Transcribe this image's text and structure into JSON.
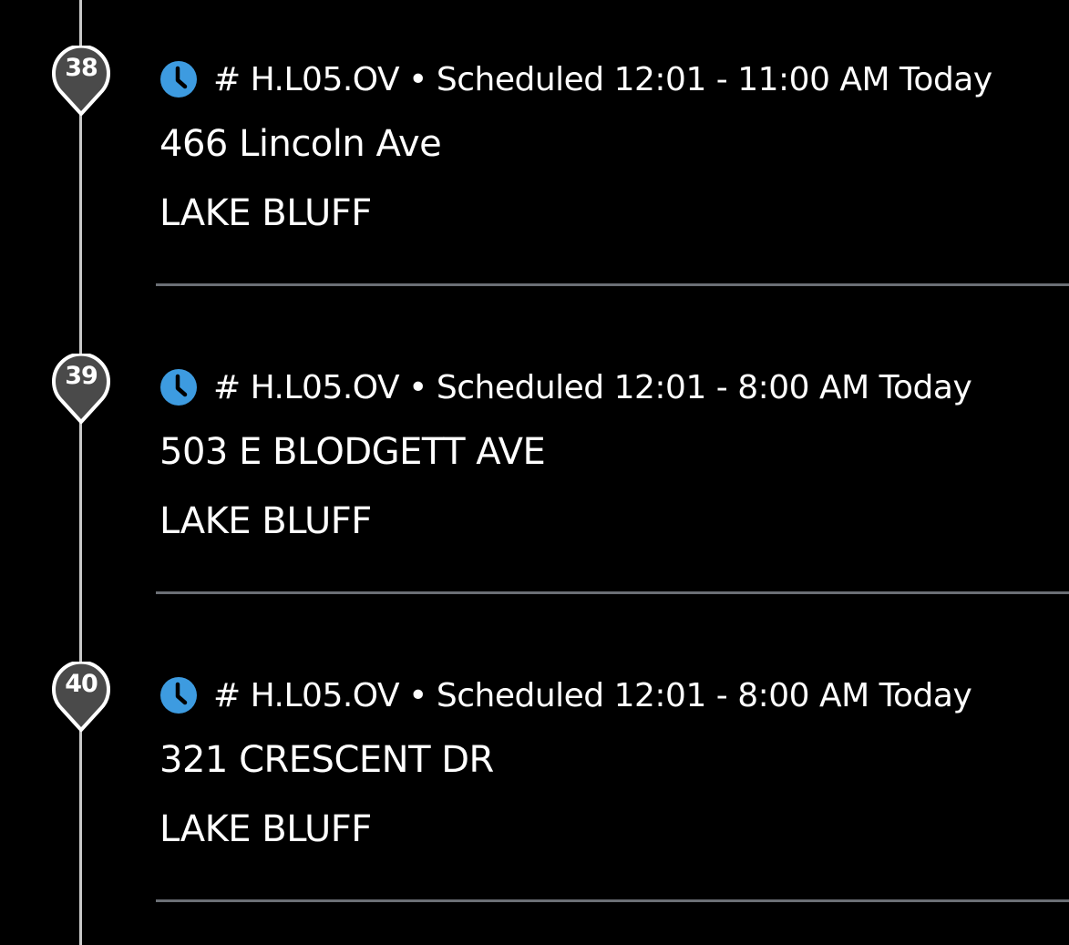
{
  "colors": {
    "background": "#000000",
    "timeline": "#c9c9c9",
    "pin_fill": "#4a4a4a",
    "pin_border": "#ffffff",
    "clock_blue": "#3d9be0",
    "divider": "#6b6f75",
    "text": "#ffffff"
  },
  "stops": [
    {
      "number": "38",
      "icon": "clock-icon",
      "code": "# H.L05.OV",
      "separator": "•",
      "schedule": "Scheduled 12:01 - 11:00 AM Today",
      "street": "466 Lincoln Ave",
      "city": "LAKE BLUFF"
    },
    {
      "number": "39",
      "icon": "clock-icon",
      "code": "# H.L05.OV",
      "separator": "•",
      "schedule": "Scheduled 12:01 - 8:00 AM Today",
      "street": "503 E BLODGETT AVE",
      "city": "LAKE BLUFF"
    },
    {
      "number": "40",
      "icon": "clock-icon",
      "code": "# H.L05.OV",
      "separator": "•",
      "schedule": "Scheduled 12:01 - 8:00 AM Today",
      "street": "321 CRESCENT DR",
      "city": "LAKE BLUFF"
    }
  ]
}
